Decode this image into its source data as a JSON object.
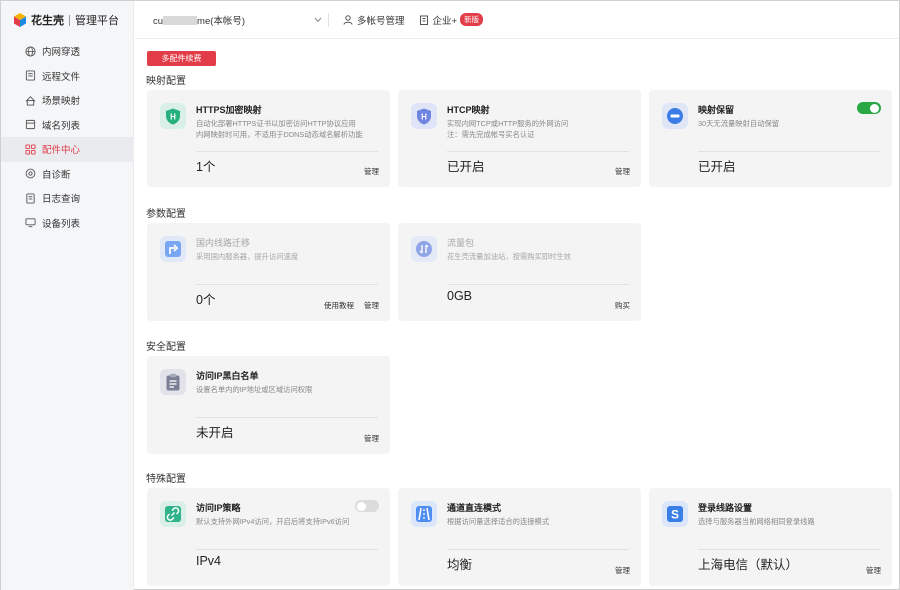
{
  "app": {
    "brand": "花生壳",
    "subtitle": "管理平台"
  },
  "sidebar": {
    "items": [
      {
        "label": "内网穿透",
        "icon": "globe-icon"
      },
      {
        "label": "远程文件",
        "icon": "file-icon"
      },
      {
        "label": "场景映射",
        "icon": "scene-icon"
      },
      {
        "label": "域名列表",
        "icon": "domain-list-icon"
      },
      {
        "label": "配件中心",
        "icon": "grid-icon",
        "active": true
      },
      {
        "label": "自诊断",
        "icon": "diagnose-icon"
      },
      {
        "label": "日志查询",
        "icon": "log-icon"
      },
      {
        "label": "设备列表",
        "icon": "device-icon"
      }
    ]
  },
  "header": {
    "account_prefix": "cu",
    "account_suffix": "me(本帐号)",
    "multi_account": "多帐号管理",
    "enterprise": "企业+",
    "new_badge": "新版"
  },
  "promo_button": "多配件续费",
  "sections": {
    "mapping": "映射配置",
    "params": "参数配置",
    "security": "安全配置",
    "special": "特殊配置"
  },
  "cards": {
    "https": {
      "title": "HTTPS加密映射",
      "desc1": "自动化部署HTTPS证书以加密访问HTTP协议应用",
      "desc2": "内网映射时可用，不适用于DDNS动态域名解析功能",
      "value": "1个",
      "action": "管理"
    },
    "htcp": {
      "title": "HTCP映射",
      "desc1": "实现内网TCP或HTTP服务的外网访问",
      "desc2": "注：需先完成帐号实名认证",
      "value": "已开启",
      "action": "管理"
    },
    "retain": {
      "title": "映射保留",
      "desc1": "30天无流量映射自动保留",
      "value": "已开启"
    },
    "domestic": {
      "title": "国内线路迁移",
      "desc1": "采用国内服务器，提升访问速度",
      "value": "0个",
      "action1": "使用教程",
      "action2": "管理"
    },
    "traffic": {
      "title": "流量包",
      "desc1": "花生壳流量加油站，按需购买即时生效",
      "value": "0GB",
      "action": "购买"
    },
    "ipacl": {
      "title": "访问IP黑白名单",
      "desc1": "设置名单内的IP地址或区域访问权限",
      "value": "未开启",
      "action": "管理"
    },
    "ipstrategy": {
      "title": "访问IP策略",
      "desc1": "默认支持外网IPv4访问，开启后将支持IPv6访问",
      "value": "IPv4"
    },
    "channel": {
      "title": "通道直连模式",
      "desc1": "根据访问量选择适合的连接模式",
      "value": "均衡",
      "action": "管理"
    },
    "loginline": {
      "title": "登录线路设置",
      "desc1": "选择与服务器当前网络相同登录线路",
      "value": "上海电信（默认）",
      "action": "管理"
    }
  },
  "colors": {
    "accent": "#e23c48",
    "toggle_on": "#28a745",
    "card_bg": "#f4f4f5"
  }
}
